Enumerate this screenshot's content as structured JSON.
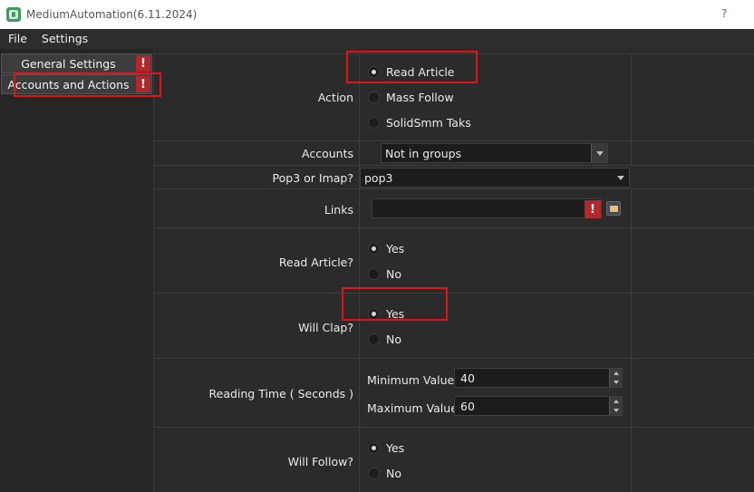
{
  "window": {
    "title": "MediumAutomation(6.11.2024)",
    "help_label": "?"
  },
  "menubar": {
    "items": [
      "File",
      "Settings"
    ]
  },
  "sidebar": {
    "items": [
      {
        "label": "General Settings",
        "warning": "!"
      },
      {
        "label": "Accounts and Actions",
        "warning": "!"
      }
    ]
  },
  "form": {
    "action": {
      "label": "Action",
      "options": [
        "Read Article",
        "Mass Follow",
        "SolidSmm Taks"
      ],
      "selected": "Read Article"
    },
    "accounts": {
      "label": "Accounts",
      "value": "Not in groups"
    },
    "pop3_imap": {
      "label": "Pop3 or Imap?",
      "value": "pop3"
    },
    "links": {
      "label": "Links",
      "value": "",
      "warning": "!"
    },
    "read_article": {
      "label": "Read Article?",
      "options": [
        "Yes",
        "No"
      ],
      "selected": "Yes"
    },
    "will_clap": {
      "label": "Will Clap?",
      "options": [
        "Yes",
        "No"
      ],
      "selected": "Yes"
    },
    "reading_time": {
      "label": "Reading Time ( Seconds )",
      "min_label": "Minimum Value",
      "min_value": "40",
      "max_label": "Maximum Value",
      "max_value": "60"
    },
    "will_follow": {
      "label": "Will Follow?",
      "options": [
        "Yes",
        "No"
      ],
      "selected": "Yes"
    }
  },
  "colors": {
    "highlight": "#e3121b",
    "warning": "#b3262b",
    "background": "#2b2b2b"
  }
}
